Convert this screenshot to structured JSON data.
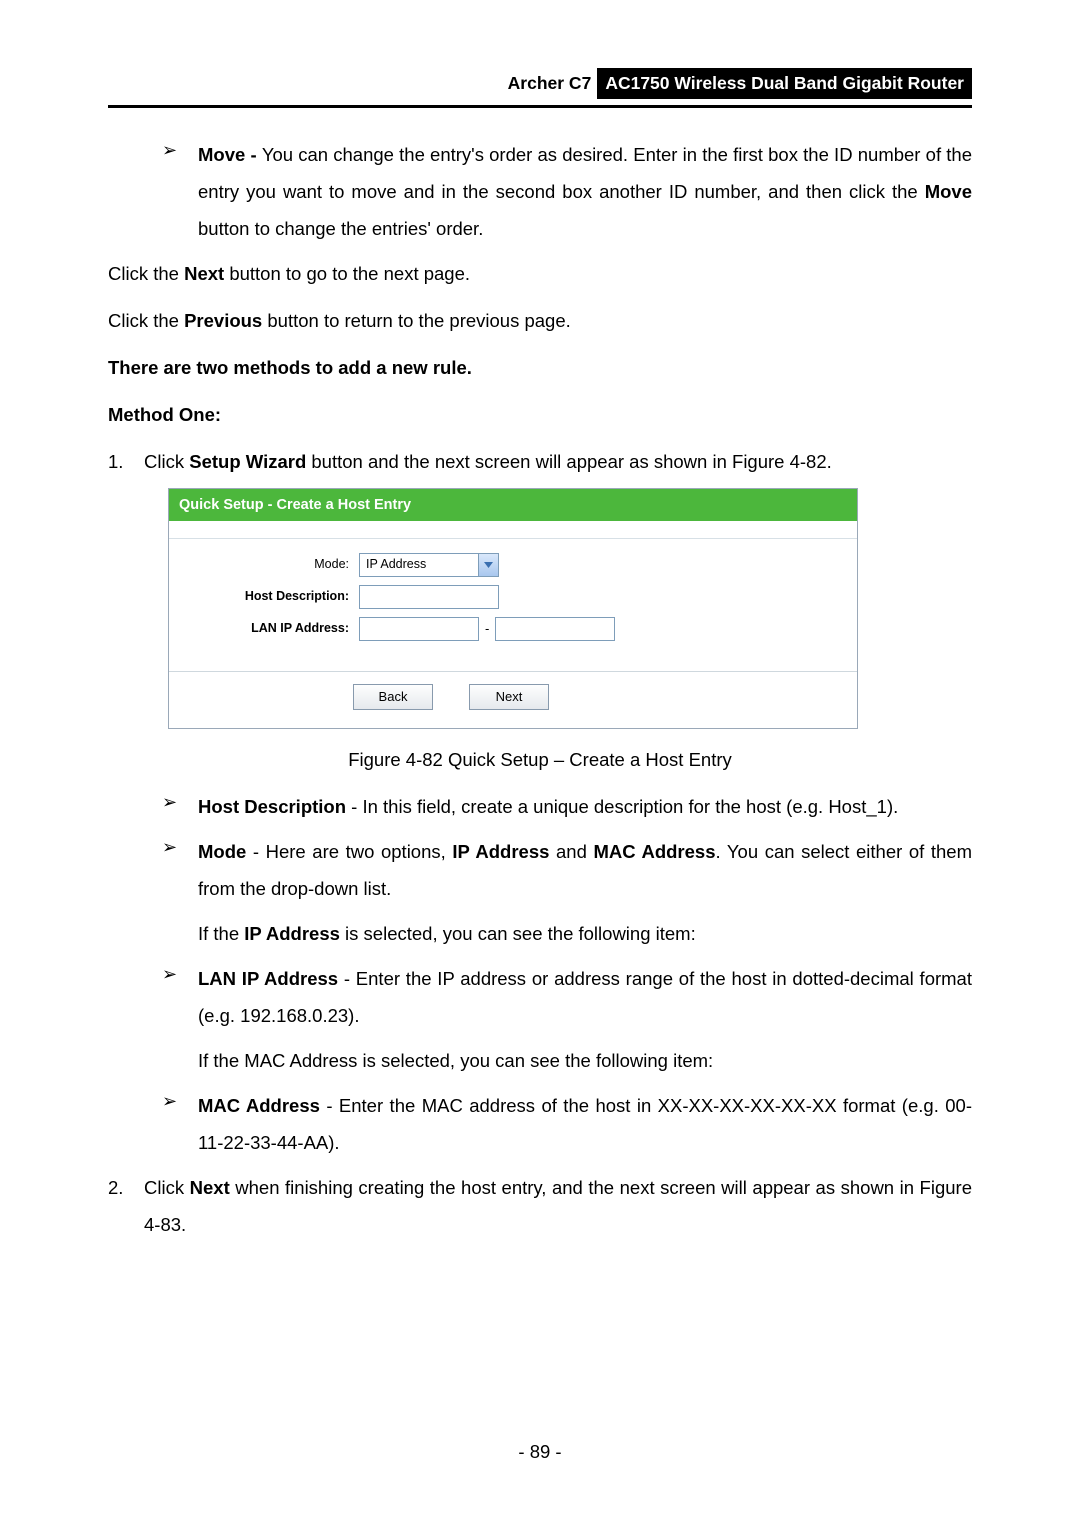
{
  "header": {
    "model": "Archer C7",
    "product": "AC1750 Wireless Dual Band Gigabit Router"
  },
  "bullet_move": {
    "label": "Move - ",
    "text": "You can change the entry's order as desired. Enter in the first box the ID number of the entry you want to move and in the second box another ID number, and then click the ",
    "bold_tail": "Move",
    "tail": " button to change the entries' order."
  },
  "click_next": {
    "pre": "Click the ",
    "bold": "Next",
    "post": " button to go to the next page."
  },
  "click_previous": {
    "pre": "Click the ",
    "bold": "Previous",
    "post": " button to return to the previous page."
  },
  "two_methods": "There are two methods to add a new rule.",
  "method_one": "Method One:",
  "step1": {
    "index": "1.",
    "pre": "Click ",
    "bold": "Setup Wizard",
    "post": " button and the next screen will appear as shown in Figure 4-82."
  },
  "figure": {
    "title": "Quick Setup - Create a Host Entry",
    "mode_label": "Mode:",
    "mode_value": "IP Address",
    "host_desc_label": "Host Description:",
    "lan_ip_label": "LAN IP Address:",
    "ip_dash": "-",
    "back_btn": "Back",
    "next_btn": "Next"
  },
  "fig_caption": "Figure 4-82 Quick Setup – Create a Host Entry",
  "b_hostdesc": {
    "bold": "Host Description",
    "post": " - In this field, create a unique description for the host (e.g. Host_1)."
  },
  "b_mode": {
    "bold": "Mode",
    "pre2": " - Here are two options, ",
    "bold2": "IP Address",
    "mid": " and ",
    "bold3": "MAC Address",
    "post": ". You can select either of them from the drop-down list."
  },
  "if_ip": {
    "pre": "If the ",
    "bold": "IP Address",
    "post": " is selected, you can see the following item:"
  },
  "b_lanip": {
    "bold": "LAN IP Address",
    "post": " - Enter the IP address or address range of the host in dotted-decimal format (e.g. 192.168.0.23)."
  },
  "if_mac": "If the MAC Address is selected, you can see the following item:",
  "b_mac": {
    "bold": "MAC Address",
    "post": " - Enter the MAC address of the host in XX-XX-XX-XX-XX-XX format (e.g. 00-11-22-33-44-AA)."
  },
  "step2": {
    "index": "2.",
    "pre": "Click ",
    "bold": "Next",
    "post": " when finishing creating the host entry, and the next screen will appear as shown in Figure 4-83."
  },
  "page_number": "- 89 -"
}
